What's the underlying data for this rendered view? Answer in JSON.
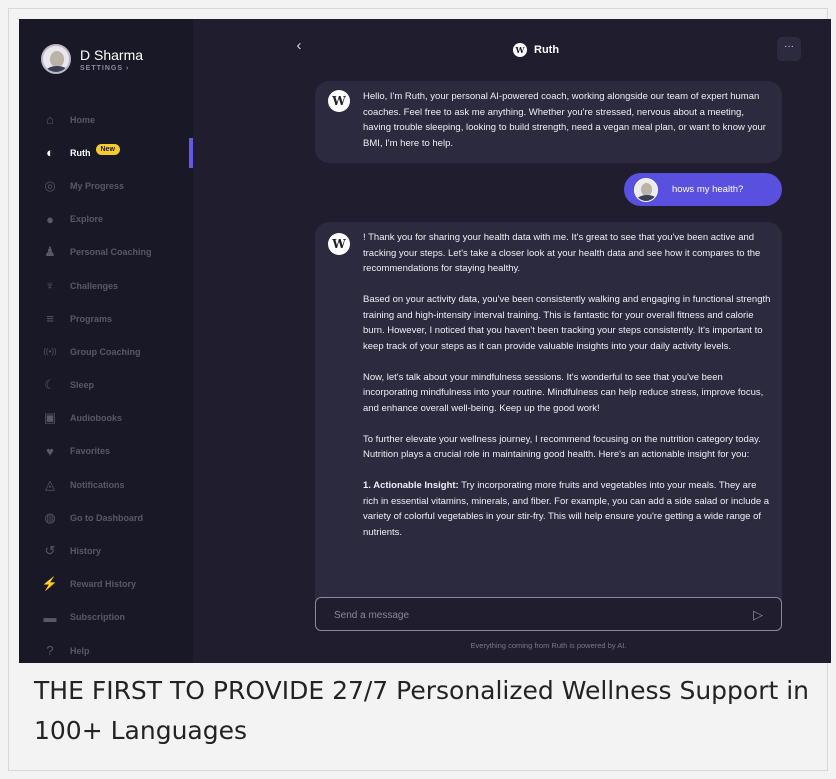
{
  "profile": {
    "name": "D Sharma",
    "subtitle": "SETTINGS ›"
  },
  "nav": [
    {
      "label": "Home",
      "icon": "home-icon",
      "glyph": "⌂",
      "active": false
    },
    {
      "label": "Ruth",
      "icon": "ruth-icon",
      "glyph": "◐",
      "active": true,
      "badge": "New"
    },
    {
      "label": "My Progress",
      "icon": "target-icon",
      "glyph": "◎",
      "active": false
    },
    {
      "label": "Explore",
      "icon": "compass-icon",
      "glyph": "●",
      "active": false
    },
    {
      "label": "Personal Coaching",
      "icon": "coach-icon",
      "glyph": "♟",
      "active": false
    },
    {
      "label": "Challenges",
      "icon": "trophy-icon",
      "glyph": "♆",
      "active": false
    },
    {
      "label": "Programs",
      "icon": "programs-icon",
      "glyph": "≡",
      "active": false
    },
    {
      "label": "Group Coaching",
      "icon": "broadcast-icon",
      "glyph": "((•))",
      "active": false
    },
    {
      "label": "Sleep",
      "icon": "moon-icon",
      "glyph": "☾",
      "active": false
    },
    {
      "label": "Audiobooks",
      "icon": "audiobook-icon",
      "glyph": "▣",
      "active": false
    },
    {
      "label": "Favorites",
      "icon": "heart-icon",
      "glyph": "♥",
      "active": false
    },
    {
      "label": "Notifications",
      "icon": "bell-icon",
      "glyph": "◬",
      "active": false
    },
    {
      "label": "Go to Dashboard",
      "icon": "dashboard-icon",
      "glyph": "◍",
      "active": false
    },
    {
      "label": "History",
      "icon": "history-icon",
      "glyph": "↺",
      "active": false
    },
    {
      "label": "Reward History",
      "icon": "bolt-icon",
      "glyph": "⚡",
      "active": false
    },
    {
      "label": "Subscription",
      "icon": "card-icon",
      "glyph": "▬",
      "active": false
    },
    {
      "label": "Help",
      "icon": "help-icon",
      "glyph": "?",
      "active": false
    }
  ],
  "chat": {
    "title": "Ruth",
    "logo_letter": "W",
    "back_glyph": "‹",
    "menu_glyph": "···",
    "messages": {
      "greeting": "Hello, I'm Ruth, your personal AI-powered coach, working alongside our team of expert human coaches. Feel free to ask me anything. Whether you're stressed, nervous about a meeting, having trouble sleeping, looking to build strength, need a vegan meal plan, or want to know your BMI, I'm here to help.",
      "user": "hows my health?",
      "reply_p1": "! Thank you for sharing your health data with me. It's great to see that you've been active and tracking your steps. Let's take a closer look at your health data and see how it compares to the recommendations for staying healthy.",
      "reply_p2": "Based on your activity data, you've been consistently walking and engaging in functional strength training and high-intensity interval training. This is fantastic for your overall fitness and calorie burn. However, I noticed that you haven't been tracking your steps consistently. It's important to keep track of your steps as it can provide valuable insights into your daily activity levels.",
      "reply_p3": "Now, let's talk about your mindfulness sessions. It's wonderful to see that you've been incorporating mindfulness into your routine. Mindfulness can help reduce stress, improve focus, and enhance overall well-being. Keep up the good work!",
      "reply_p4": "To further elevate your wellness journey, I recommend focusing on the nutrition category today. Nutrition plays a crucial role in maintaining good health. Here's an actionable insight for you:",
      "reply_p5_bold": "1. Actionable Insight:",
      "reply_p5": " Try incorporating more fruits and vegetables into your meals. They are rich in essential vitamins, minerals, and fiber. For example, you can add a side salad or include a variety of colorful vegetables in your stir-fry. This will help ensure you're getting a wide range of nutrients."
    },
    "input_placeholder": "Send a message",
    "send_glyph": "▷",
    "disclaimer": "Everything coming from Ruth is powered by AI."
  },
  "caption": "THE FIRST TO PROVIDE 27/7 Personalized Wellness Support in 100+ Languages",
  "colors": {
    "accent": "#6259e8",
    "user_bubble": "#5a50e0",
    "badge": "#f5cb2e",
    "sidebar": "#191827",
    "main": "#1f1d2e",
    "bubble": "#2b2a3e"
  }
}
